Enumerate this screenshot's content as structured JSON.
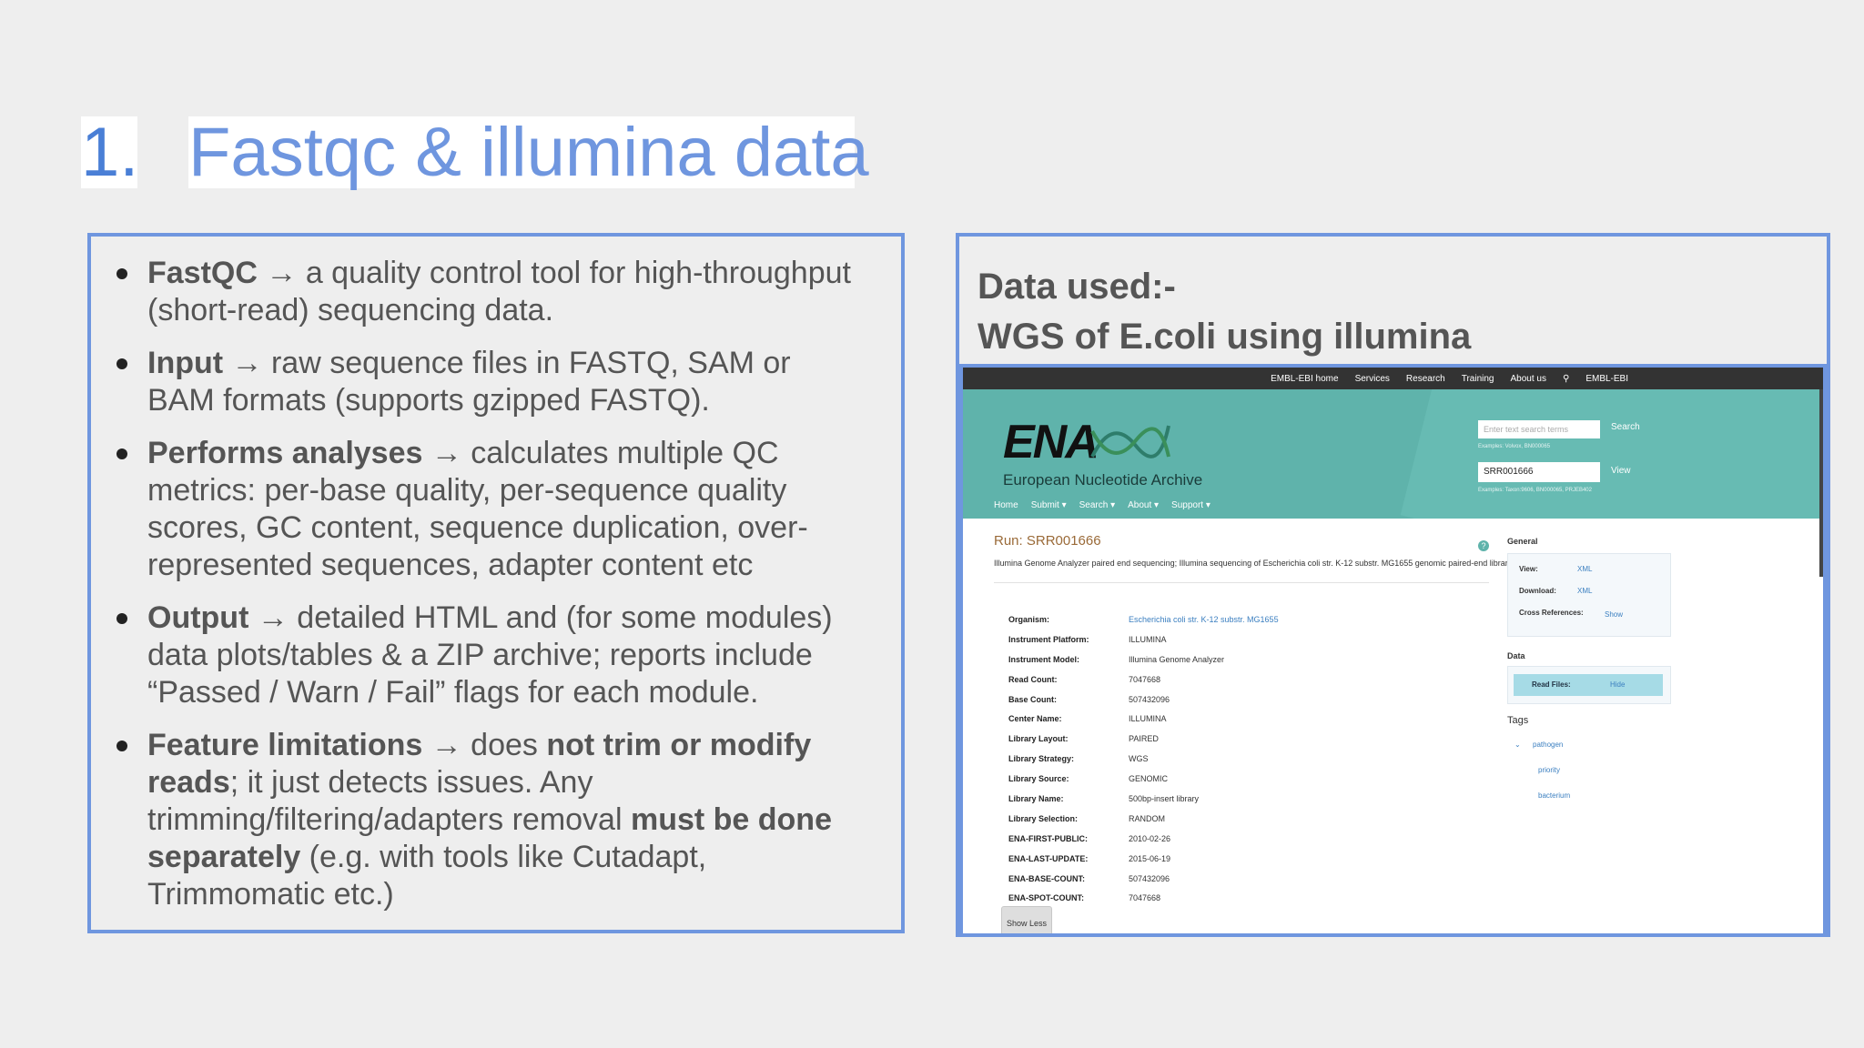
{
  "slide": {
    "title_number": "1.",
    "title_text": "Fastqc & illumina data"
  },
  "bullets": [
    {
      "bold": "FastQC",
      "text": " → a quality control tool for high-throughput (short-read) sequencing data."
    },
    {
      "bold": "Input",
      "text": " → raw sequence files in FASTQ, SAM or BAM formats (supports gzipped FASTQ)."
    },
    {
      "bold": "Performs analyses",
      "text": " → calculates multiple QC metrics: per-base quality, per-sequence quality scores, GC content, sequence duplication, over-represented sequences, adapter content etc"
    },
    {
      "bold": "Output",
      "text": " → detailed HTML and (for some modules) data plots/tables & a ZIP archive; reports include “Passed / Warn / Fail” flags for each module."
    },
    {
      "bold": "Feature limitations",
      "text_a": " → does ",
      "bold_b": "not trim or modify reads",
      "text_c": "; it just detects issues. Any trimming/filtering/adapters removal ",
      "bold_d": "must be done separately",
      "text_e": " (e.g. with tools like Cutadapt, Trimmomatic etc.)"
    }
  ],
  "data_used": {
    "line1": "Data used:-",
    "line2": "WGS of E.coli using illumina"
  },
  "ena": {
    "topbar": [
      "EMBL-EBI home",
      "Services",
      "Research",
      "Training",
      "About us",
      "EMBL-EBI"
    ],
    "logo": "ENA",
    "logo_sub": "European Nucleotide Archive",
    "nav": [
      "Home",
      "Submit ▾",
      "Search ▾",
      "About ▾",
      "Support ▾"
    ],
    "search_placeholder": "Enter text search terms",
    "search_btn": "Search",
    "search_examples": "Examples: Volvox, BN000065",
    "accession_value": "SRR001666",
    "view_btn": "View",
    "view_examples": "Examples: Taxon:9606, BN000065, PRJEB402",
    "run_title": "Run: SRR001666",
    "run_desc": "Illumina Genome Analyzer paired end sequencing; Illumina sequencing of Escherichia coli str. K-12 substr. MG1655 genomic paired-end library",
    "help": "?",
    "metadata": [
      {
        "k": "Organism:",
        "v": "Escherichia coli str. K-12 substr. MG1655",
        "link": true
      },
      {
        "k": "Instrument Platform:",
        "v": "ILLUMINA"
      },
      {
        "k": "Instrument Model:",
        "v": "Illumina Genome Analyzer"
      },
      {
        "k": "Read Count:",
        "v": "7047668"
      },
      {
        "k": "Base Count:",
        "v": "507432096"
      },
      {
        "k": "Center Name:",
        "v": "ILLUMINA"
      },
      {
        "k": "Library Layout:",
        "v": "PAIRED"
      },
      {
        "k": "Library Strategy:",
        "v": "WGS"
      },
      {
        "k": "Library Source:",
        "v": "GENOMIC"
      },
      {
        "k": "Library Name:",
        "v": "500bp-insert library"
      },
      {
        "k": "Library Selection:",
        "v": "RANDOM"
      },
      {
        "k": "ENA-FIRST-PUBLIC:",
        "v": "2010-02-26"
      },
      {
        "k": "ENA-LAST-UPDATE:",
        "v": "2015-06-19"
      },
      {
        "k": "ENA-BASE-COUNT:",
        "v": "507432096"
      },
      {
        "k": "ENA-SPOT-COUNT:",
        "v": "7047668"
      }
    ],
    "show_less": "Show Less",
    "general": {
      "heading": "General",
      "view_label": "View:",
      "view_link": "XML",
      "download_label": "Download:",
      "download_link": "XML",
      "xref_label": "Cross References:",
      "xref_link": "Show"
    },
    "data": {
      "heading": "Data",
      "read_files": "Read Files:",
      "hide": "Hide"
    },
    "tags": {
      "heading": "Tags",
      "items": [
        "pathogen",
        "priority",
        "bacterium"
      ]
    }
  },
  "colors": {
    "accent_blue": "#6f96df",
    "ena_teal": "#5fb3ab",
    "run_brown": "#9a6a38"
  }
}
